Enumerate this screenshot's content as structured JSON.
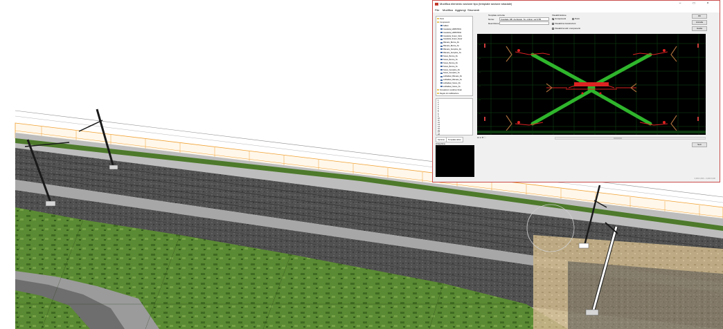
{
  "window": {
    "title": "Modifica elemento sezione tipo (template sezione stradale)",
    "controls": [
      "–",
      "□",
      "×"
    ]
  },
  "menubar": {
    "items": [
      "File",
      "Modifica",
      "Aggiungi",
      "Strumenti"
    ]
  },
  "tree": {
    "items": [
      {
        "label": "Punti",
        "icon": "folder"
      },
      {
        "label": "Componenti",
        "icon": "folder"
      },
      {
        "label": "ballast",
        "icon": "component"
      },
      {
        "label": "Canaletta_HNBSTR01",
        "icon": "component"
      },
      {
        "label": "Canaletta_HNBSTR02",
        "icon": "component"
      },
      {
        "label": "Canaletta_Scavo_Sinis",
        "icon": "component"
      },
      {
        "label": "Canaletta_Scavo_Destr",
        "icon": "component"
      },
      {
        "label": "Rilevato_Berma_Dx",
        "icon": "component"
      },
      {
        "label": "Rilevato_Berma_Sx",
        "icon": "component"
      },
      {
        "label": "Rilevato_Semplice_Dx",
        "icon": "component"
      },
      {
        "label": "Rilevato_Semplice_Sx",
        "icon": "component"
      },
      {
        "label": "Scavo_Berma_Dx",
        "icon": "component"
      },
      {
        "label": "Scavo_Berma_Sx",
        "icon": "component"
      },
      {
        "label": "Scavo_Berma_Dx",
        "icon": "component"
      },
      {
        "label": "Scavo_Berma_Sx",
        "icon": "component"
      },
      {
        "label": "Scavo_Semplice_Dx",
        "icon": "component"
      },
      {
        "label": "Scavo_Semplice_Sx",
        "icon": "component"
      },
      {
        "label": "subballast_Rilevato_Dx",
        "icon": "component"
      },
      {
        "label": "subballast_Rilevato_Sx",
        "icon": "component"
      },
      {
        "label": "subballast_Scavo_Dx",
        "icon": "component"
      },
      {
        "label": "subballast_Scavo_Sx",
        "icon": "component"
      },
      {
        "label": "Simulazioni condizioni finali",
        "icon": "folder"
      },
      {
        "label": "Regole di modificazione",
        "icon": "folder"
      }
    ]
  },
  "point_list": {
    "items": [
      "1",
      "2",
      "3",
      "4",
      "5",
      "6",
      "7",
      "8",
      "9",
      "10",
      "11",
      "12",
      "13",
      "14",
      "15",
      "16",
      "17",
      "18"
    ]
  },
  "tabs": [
    "Sezione",
    "Template attivo"
  ],
  "preview": {
    "label": "Anteprima"
  },
  "template_group": {
    "header": "Template corrente",
    "name_label": "Nome:",
    "name_value": "Insediata_DB_di+rilevato_Sx_ordinej_ver=LTB",
    "description_label": "Descrizione:",
    "description_value": ""
  },
  "display_group": {
    "header": "Visualizzazione",
    "radio_components": "Componenti",
    "radio_points": "Punti",
    "check1": "Visualizza ricostruzioni",
    "check2": "Visualizza tutti i componenti"
  },
  "buttons": {
    "ok": "OK",
    "cancel": "Annulla",
    "help": "Guida",
    "apply": "Sezi"
  },
  "status_text": "0,000 0,000 – 0,000 0,000",
  "colors": {
    "canvas_bg": "#000000",
    "grid": "#114c14",
    "lines_green": "#2fb52c",
    "lines_red": "#dd2222",
    "dialog_border": "#c94a4a",
    "grass": "#4d7a2b",
    "ballast": "#4f4f4f",
    "concrete": "#a7a7a7",
    "orange_wall": "#f0a030"
  }
}
